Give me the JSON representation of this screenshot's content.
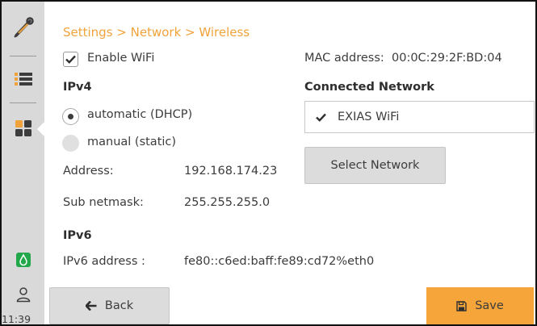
{
  "sidebar": {
    "icons": [
      "wrench-icon",
      "list-icon",
      "grid-icon",
      "status-icon",
      "user-icon"
    ],
    "clock": "11:39",
    "status_color": "#22a84a"
  },
  "breadcrumb": "Settings > Network > Wireless",
  "wifi": {
    "enable_label": "Enable WiFi",
    "enabled": true,
    "mac_label": "MAC address:",
    "mac_value": "00:0C:29:2F:BD:04"
  },
  "ipv4": {
    "heading": "IPv4",
    "options": [
      {
        "label": "automatic (DHCP)",
        "selected": true
      },
      {
        "label": "manual (static)",
        "selected": false
      }
    ],
    "address_label": "Address:",
    "address_value": "192.168.174.23",
    "netmask_label": "Sub netmask:",
    "netmask_value": "255.255.255.0"
  },
  "connected": {
    "heading": "Connected Network",
    "network": "EXIAS WiFi",
    "select_button": "Select Network"
  },
  "ipv6": {
    "heading": "IPv6",
    "address_label": "IPv6 address :",
    "address_value": "fe80::c6ed:baff:fe89:cd72%eth0"
  },
  "actions": {
    "back": "Back",
    "save": "Save"
  },
  "colors": {
    "accent": "#f0a33b",
    "save_button": "#f5a53a",
    "sidebar": "#d9d9d9",
    "icon_orange": "#f0a33b"
  }
}
